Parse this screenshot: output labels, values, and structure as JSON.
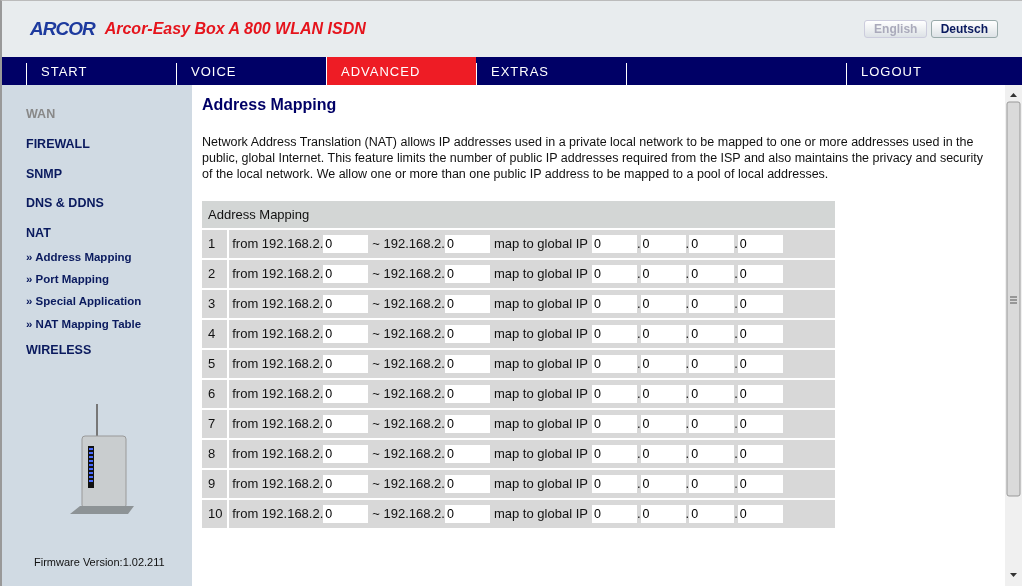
{
  "header": {
    "logo": "ARCOR",
    "product": "Arcor-Easy Box A 800 WLAN ISDN",
    "languages": [
      {
        "label": "English",
        "selected": false
      },
      {
        "label": "Deutsch",
        "selected": true
      }
    ]
  },
  "nav": [
    {
      "label": "START",
      "selected": false
    },
    {
      "label": "VOICE",
      "selected": false
    },
    {
      "label": "ADVANCED",
      "selected": true
    },
    {
      "label": "EXTRAS",
      "selected": false
    },
    {
      "selected": false
    },
    {
      "label": "LOGOUT",
      "selected": false
    }
  ],
  "sidebar": {
    "items": [
      {
        "label": "WAN",
        "disabled": true
      },
      {
        "label": "FIREWALL",
        "disabled": false
      },
      {
        "label": "SNMP",
        "disabled": false
      },
      {
        "label": "DNS & DDNS",
        "disabled": false
      },
      {
        "label": "NAT",
        "disabled": false,
        "children": [
          {
            "label": "» Address Mapping"
          },
          {
            "label": "» Port Mapping"
          },
          {
            "label": "» Special Application"
          },
          {
            "label": "» NAT Mapping Table"
          }
        ]
      },
      {
        "label": "WIRELESS",
        "disabled": false
      }
    ],
    "firmware": "Firmware Version:1.02.211"
  },
  "page": {
    "title": "Address Mapping",
    "description": "Network Address Translation (NAT) allows IP addresses used in a private local network to be mapped to one or more addresses used in the public, global Internet. This feature limits the number of public IP addresses required from the ISP and also maintains the privacy and security of the local network. We allow one or more than one public IP address to be mapped to a pool of local addresses."
  },
  "table": {
    "title": "Address Mapping",
    "rows": [
      {
        "number": "1",
        "from": "from 192.168.2.",
        "start": "0",
        "to": "~ 192.168.2.",
        "end": "0",
        "map": "map to global IP",
        "octets": [
          {
            "value": "0"
          },
          {
            "sep": ".",
            "value": "0"
          },
          {
            "sep": ".",
            "value": "0"
          },
          {
            "sep": ".",
            "value": "0"
          }
        ]
      },
      {
        "number": "2",
        "from": "from 192.168.2.",
        "start": "0",
        "to": "~ 192.168.2.",
        "end": "0",
        "map": "map to global IP",
        "octets": [
          {
            "value": "0"
          },
          {
            "sep": ".",
            "value": "0"
          },
          {
            "sep": ".",
            "value": "0"
          },
          {
            "sep": ".",
            "value": "0"
          }
        ]
      },
      {
        "number": "3",
        "from": "from 192.168.2.",
        "start": "0",
        "to": "~ 192.168.2.",
        "end": "0",
        "map": "map to global IP",
        "octets": [
          {
            "value": "0"
          },
          {
            "sep": ".",
            "value": "0"
          },
          {
            "sep": ".",
            "value": "0"
          },
          {
            "sep": ".",
            "value": "0"
          }
        ]
      },
      {
        "number": "4",
        "from": "from 192.168.2.",
        "start": "0",
        "to": "~ 192.168.2.",
        "end": "0",
        "map": "map to global IP",
        "octets": [
          {
            "value": "0"
          },
          {
            "sep": ".",
            "value": "0"
          },
          {
            "sep": ".",
            "value": "0"
          },
          {
            "sep": ".",
            "value": "0"
          }
        ]
      },
      {
        "number": "5",
        "from": "from 192.168.2.",
        "start": "0",
        "to": "~ 192.168.2.",
        "end": "0",
        "map": "map to global IP",
        "octets": [
          {
            "value": "0"
          },
          {
            "sep": ".",
            "value": "0"
          },
          {
            "sep": ".",
            "value": "0"
          },
          {
            "sep": ".",
            "value": "0"
          }
        ]
      },
      {
        "number": "6",
        "from": "from 192.168.2.",
        "start": "0",
        "to": "~ 192.168.2.",
        "end": "0",
        "map": "map to global IP",
        "octets": [
          {
            "value": "0"
          },
          {
            "sep": ".",
            "value": "0"
          },
          {
            "sep": ".",
            "value": "0"
          },
          {
            "sep": ".",
            "value": "0"
          }
        ]
      },
      {
        "number": "7",
        "from": "from 192.168.2.",
        "start": "0",
        "to": "~ 192.168.2.",
        "end": "0",
        "map": "map to global IP",
        "octets": [
          {
            "value": "0"
          },
          {
            "sep": ".",
            "value": "0"
          },
          {
            "sep": ".",
            "value": "0"
          },
          {
            "sep": ".",
            "value": "0"
          }
        ]
      },
      {
        "number": "8",
        "from": "from 192.168.2.",
        "start": "0",
        "to": "~ 192.168.2.",
        "end": "0",
        "map": "map to global IP",
        "octets": [
          {
            "value": "0"
          },
          {
            "sep": ".",
            "value": "0"
          },
          {
            "sep": ".",
            "value": "0"
          },
          {
            "sep": ".",
            "value": "0"
          }
        ]
      },
      {
        "number": "9",
        "from": "from 192.168.2.",
        "start": "0",
        "to": "~ 192.168.2.",
        "end": "0",
        "map": "map to global IP",
        "octets": [
          {
            "value": "0"
          },
          {
            "sep": ".",
            "value": "0"
          },
          {
            "sep": ".",
            "value": "0"
          },
          {
            "sep": ".",
            "value": "0"
          }
        ]
      },
      {
        "number": "10",
        "from": "from 192.168.2.",
        "start": "0",
        "to": "~ 192.168.2.",
        "end": "0",
        "map": "map to global IP",
        "octets": [
          {
            "value": "0"
          },
          {
            "sep": ".",
            "value": "0"
          },
          {
            "sep": ".",
            "value": "0"
          },
          {
            "sep": ".",
            "value": "0"
          }
        ]
      }
    ]
  }
}
